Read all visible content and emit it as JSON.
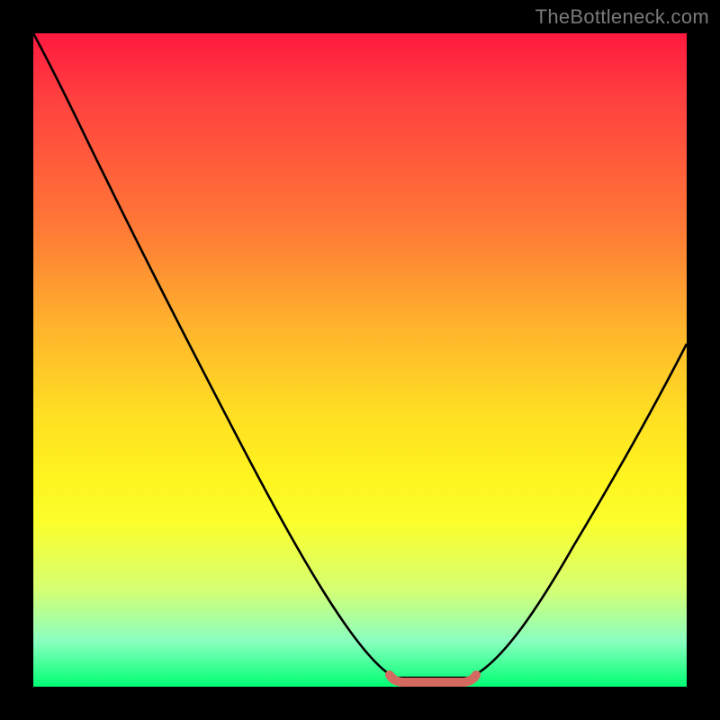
{
  "watermark": "TheBottleneck.com",
  "chart_data": {
    "type": "line",
    "title": "",
    "xlabel": "",
    "ylabel": "",
    "xlim": [
      0,
      100
    ],
    "ylim": [
      0,
      100
    ],
    "series": [
      {
        "name": "bottleneck-curve",
        "x": [
          0,
          5,
          10,
          15,
          20,
          25,
          30,
          35,
          40,
          45,
          50,
          55,
          58,
          62,
          66,
          70,
          75,
          80,
          85,
          90,
          95,
          100
        ],
        "values": [
          100,
          91,
          82,
          73,
          64,
          55,
          46,
          37,
          28,
          19,
          10,
          2.5,
          1,
          1,
          1,
          2.5,
          10,
          21,
          32,
          44,
          55,
          66
        ]
      },
      {
        "name": "optimal-range",
        "x": [
          56,
          58,
          60,
          62,
          64,
          66,
          68
        ],
        "values": [
          2.2,
          1.4,
          1.0,
          1.0,
          1.0,
          1.4,
          2.2
        ]
      }
    ],
    "colors": {
      "curve": "#000000",
      "optimal": "#d46a5f"
    },
    "background_gradient": [
      "#ff193f",
      "#ffde23",
      "#00ff73"
    ]
  }
}
